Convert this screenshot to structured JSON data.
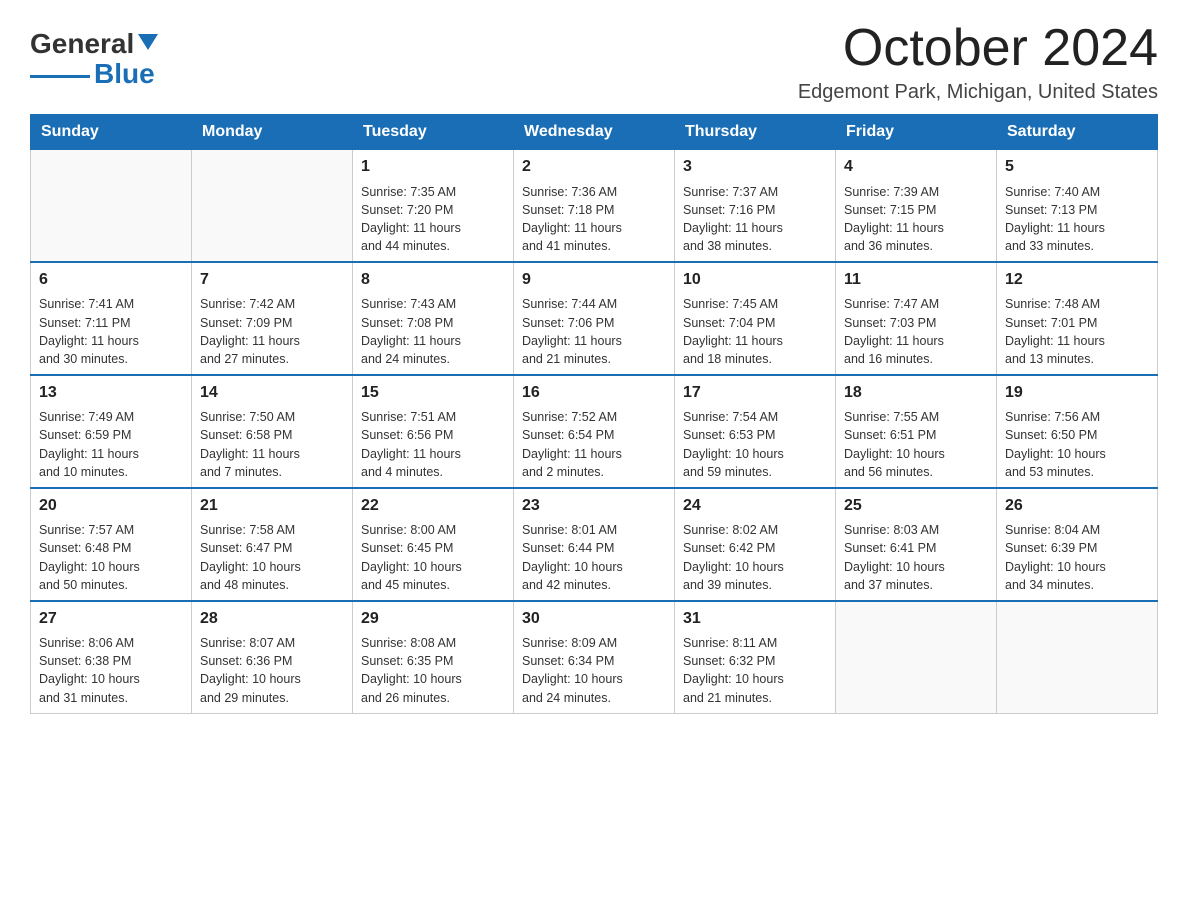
{
  "header": {
    "logo_general": "General",
    "logo_blue": "Blue",
    "title": "October 2024",
    "location": "Edgemont Park, Michigan, United States"
  },
  "days_of_week": [
    "Sunday",
    "Monday",
    "Tuesday",
    "Wednesday",
    "Thursday",
    "Friday",
    "Saturday"
  ],
  "weeks": [
    [
      {
        "day": "",
        "info": ""
      },
      {
        "day": "",
        "info": ""
      },
      {
        "day": "1",
        "info": "Sunrise: 7:35 AM\nSunset: 7:20 PM\nDaylight: 11 hours\nand 44 minutes."
      },
      {
        "day": "2",
        "info": "Sunrise: 7:36 AM\nSunset: 7:18 PM\nDaylight: 11 hours\nand 41 minutes."
      },
      {
        "day": "3",
        "info": "Sunrise: 7:37 AM\nSunset: 7:16 PM\nDaylight: 11 hours\nand 38 minutes."
      },
      {
        "day": "4",
        "info": "Sunrise: 7:39 AM\nSunset: 7:15 PM\nDaylight: 11 hours\nand 36 minutes."
      },
      {
        "day": "5",
        "info": "Sunrise: 7:40 AM\nSunset: 7:13 PM\nDaylight: 11 hours\nand 33 minutes."
      }
    ],
    [
      {
        "day": "6",
        "info": "Sunrise: 7:41 AM\nSunset: 7:11 PM\nDaylight: 11 hours\nand 30 minutes."
      },
      {
        "day": "7",
        "info": "Sunrise: 7:42 AM\nSunset: 7:09 PM\nDaylight: 11 hours\nand 27 minutes."
      },
      {
        "day": "8",
        "info": "Sunrise: 7:43 AM\nSunset: 7:08 PM\nDaylight: 11 hours\nand 24 minutes."
      },
      {
        "day": "9",
        "info": "Sunrise: 7:44 AM\nSunset: 7:06 PM\nDaylight: 11 hours\nand 21 minutes."
      },
      {
        "day": "10",
        "info": "Sunrise: 7:45 AM\nSunset: 7:04 PM\nDaylight: 11 hours\nand 18 minutes."
      },
      {
        "day": "11",
        "info": "Sunrise: 7:47 AM\nSunset: 7:03 PM\nDaylight: 11 hours\nand 16 minutes."
      },
      {
        "day": "12",
        "info": "Sunrise: 7:48 AM\nSunset: 7:01 PM\nDaylight: 11 hours\nand 13 minutes."
      }
    ],
    [
      {
        "day": "13",
        "info": "Sunrise: 7:49 AM\nSunset: 6:59 PM\nDaylight: 11 hours\nand 10 minutes."
      },
      {
        "day": "14",
        "info": "Sunrise: 7:50 AM\nSunset: 6:58 PM\nDaylight: 11 hours\nand 7 minutes."
      },
      {
        "day": "15",
        "info": "Sunrise: 7:51 AM\nSunset: 6:56 PM\nDaylight: 11 hours\nand 4 minutes."
      },
      {
        "day": "16",
        "info": "Sunrise: 7:52 AM\nSunset: 6:54 PM\nDaylight: 11 hours\nand 2 minutes."
      },
      {
        "day": "17",
        "info": "Sunrise: 7:54 AM\nSunset: 6:53 PM\nDaylight: 10 hours\nand 59 minutes."
      },
      {
        "day": "18",
        "info": "Sunrise: 7:55 AM\nSunset: 6:51 PM\nDaylight: 10 hours\nand 56 minutes."
      },
      {
        "day": "19",
        "info": "Sunrise: 7:56 AM\nSunset: 6:50 PM\nDaylight: 10 hours\nand 53 minutes."
      }
    ],
    [
      {
        "day": "20",
        "info": "Sunrise: 7:57 AM\nSunset: 6:48 PM\nDaylight: 10 hours\nand 50 minutes."
      },
      {
        "day": "21",
        "info": "Sunrise: 7:58 AM\nSunset: 6:47 PM\nDaylight: 10 hours\nand 48 minutes."
      },
      {
        "day": "22",
        "info": "Sunrise: 8:00 AM\nSunset: 6:45 PM\nDaylight: 10 hours\nand 45 minutes."
      },
      {
        "day": "23",
        "info": "Sunrise: 8:01 AM\nSunset: 6:44 PM\nDaylight: 10 hours\nand 42 minutes."
      },
      {
        "day": "24",
        "info": "Sunrise: 8:02 AM\nSunset: 6:42 PM\nDaylight: 10 hours\nand 39 minutes."
      },
      {
        "day": "25",
        "info": "Sunrise: 8:03 AM\nSunset: 6:41 PM\nDaylight: 10 hours\nand 37 minutes."
      },
      {
        "day": "26",
        "info": "Sunrise: 8:04 AM\nSunset: 6:39 PM\nDaylight: 10 hours\nand 34 minutes."
      }
    ],
    [
      {
        "day": "27",
        "info": "Sunrise: 8:06 AM\nSunset: 6:38 PM\nDaylight: 10 hours\nand 31 minutes."
      },
      {
        "day": "28",
        "info": "Sunrise: 8:07 AM\nSunset: 6:36 PM\nDaylight: 10 hours\nand 29 minutes."
      },
      {
        "day": "29",
        "info": "Sunrise: 8:08 AM\nSunset: 6:35 PM\nDaylight: 10 hours\nand 26 minutes."
      },
      {
        "day": "30",
        "info": "Sunrise: 8:09 AM\nSunset: 6:34 PM\nDaylight: 10 hours\nand 24 minutes."
      },
      {
        "day": "31",
        "info": "Sunrise: 8:11 AM\nSunset: 6:32 PM\nDaylight: 10 hours\nand 21 minutes."
      },
      {
        "day": "",
        "info": ""
      },
      {
        "day": "",
        "info": ""
      }
    ]
  ]
}
